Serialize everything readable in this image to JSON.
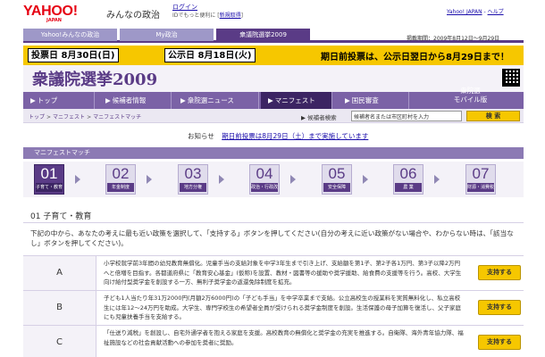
{
  "header": {
    "logo_text": "YAHOO!",
    "logo_sub": "JAPAN",
    "site_name": "みんなの政治",
    "login_label": "ログイン",
    "login_desc": "IDでもっと便利に",
    "register_label": "新規取得",
    "top_right": [
      "Yahoo! JAPAN",
      "ヘルプ"
    ]
  },
  "tabs": [
    {
      "label": "Yahoo!みんなの政治"
    },
    {
      "label": "My政治"
    },
    {
      "label": "衆議院選挙2009"
    }
  ],
  "updated": "掲載期間：2009年8月12日〜9月29日",
  "banner": {
    "vote_day": "投票日 8月30日(日)",
    "announce_day": "公示日 8月18日(火)",
    "early_vote": "期日前投票は、公示日翌日から8月29日まで！"
  },
  "title": "衆議院選挙2009",
  "nav": {
    "items": [
      "トップ",
      "候補者情報",
      "衆院選ニュース",
      "マニフェスト",
      "国民審査"
    ],
    "mobile_line1": "衆院選",
    "mobile_line2": "モバイル版"
  },
  "breadcrumb": [
    "トップ",
    "マニフェスト",
    "マニフェストマッチ"
  ],
  "search": {
    "label": "候補者検索",
    "value": "候補者名または市区町村を入力",
    "button": "検 索"
  },
  "notice": {
    "label": "お知らせ",
    "link": "期日前投票は8月29日（土）まで実施しています"
  },
  "section_title": "マニフェストマッチ",
  "steps": [
    {
      "num": "01",
      "label": "子育て・教育"
    },
    {
      "num": "02",
      "label": "年金制度"
    },
    {
      "num": "03",
      "label": "地方分権"
    },
    {
      "num": "04",
      "label": "政治・行政改革"
    },
    {
      "num": "05",
      "label": "安全保障"
    },
    {
      "num": "06",
      "label": "農 業"
    },
    {
      "num": "07",
      "label": "財源・消費税"
    }
  ],
  "topic": "01 子育て・教育",
  "intro": "下記の中から、あなたの考えに最も近い政策を選択して、「支持する」ボタンを押してください(自分の考えに近い政策がない場合や、わからない時は、「該当なし」ボタンを押してください)。",
  "options": [
    {
      "letter": "A",
      "text": "小学校就学前3年間の幼児教育無償化。児童手当の支給対象を中学3年生まで引き上げ、支給額を第1子、第2子各1万円、第3子以降2万円へと倍増を目指す。各都道府県に「教育安心基金」(仮称)を設置、教材・図書等の援助や奨学援助、給食費の支援等を行う。高校、大学生向け給付型奨学金を創設する一方、無利子奨学金の返還免除制度を拡充。",
      "button": "支持する"
    },
    {
      "letter": "B",
      "text": "子ども1人当たり年31万2000円(月額2万6000円)の「子ども手当」を中学卒業まで支給。公立高校生の授業料を実質無料化し、私立高校生には年12〜24万円を助成。大学生、専門学校生の希望者全員が受けられる奨学金制度を創設。生活保護の母子加算を復活し、父子家庭にも児童扶養手当を支給する。",
      "button": "支持する"
    },
    {
      "letter": "C",
      "text": "「仕送り減税」を創設し、自宅外通学者を抱える家庭を支援。高校教育の無償化と奨学金の充実を推進する。自衛隊、海外青年協力隊、福祉施設などの社会貢献活動への参加を奨者に奨励。",
      "button": "支持する"
    }
  ]
}
